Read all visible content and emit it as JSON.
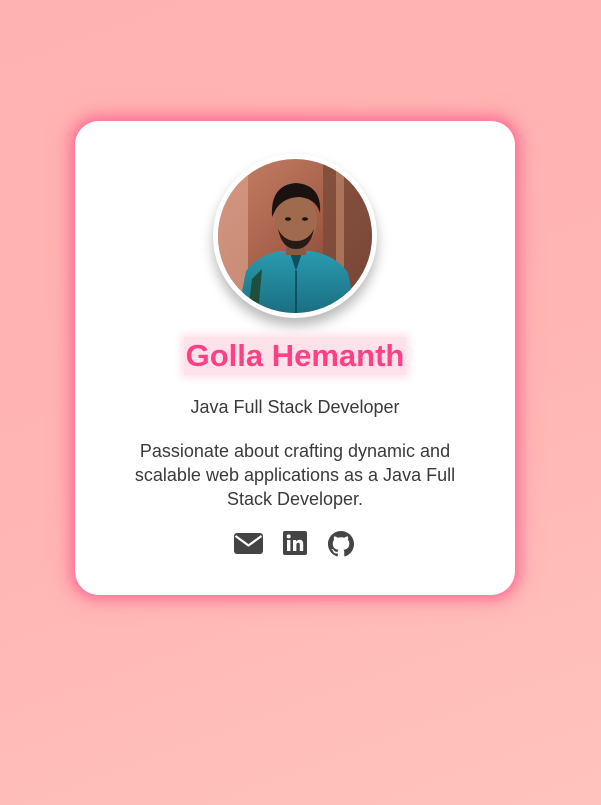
{
  "profile": {
    "name": "Golla Hemanth",
    "role": "Java Full Stack Developer",
    "bio": "Passionate about crafting dynamic and scalable web applications as a Java Full Stack Developer."
  },
  "socials": [
    {
      "icon": "envelope-icon",
      "label": "Email"
    },
    {
      "icon": "linkedin-icon",
      "label": "LinkedIn"
    },
    {
      "icon": "github-icon",
      "label": "GitHub"
    }
  ],
  "colors": {
    "accent": "#ff3f86",
    "text": "#3a3a3a",
    "icon": "#444444",
    "card": "#ffffff",
    "background": "#ffb5b3"
  }
}
